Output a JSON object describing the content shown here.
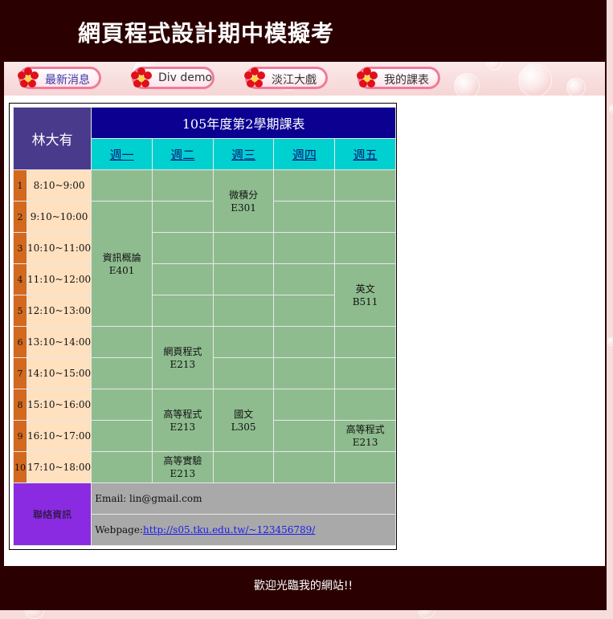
{
  "header": {
    "title": "網頁程式設計期中模擬考"
  },
  "nav": {
    "items": [
      {
        "label": "最新消息"
      },
      {
        "label": "Div demo"
      },
      {
        "label": "淡江大戲"
      },
      {
        "label": "我的課表"
      }
    ]
  },
  "schedule": {
    "owner": "林大有",
    "title": "105年度第2學期課表",
    "days": [
      "週一",
      "週二",
      "週三",
      "週四",
      "週五"
    ],
    "periods": [
      {
        "num": "1",
        "time": "8:10~9:00"
      },
      {
        "num": "2",
        "time": "9:10~10:00"
      },
      {
        "num": "3",
        "time": "10:10~11:00"
      },
      {
        "num": "4",
        "time": "11:10~12:00"
      },
      {
        "num": "5",
        "time": "12:10~13:00"
      },
      {
        "num": "6",
        "time": "13:10~14:00"
      },
      {
        "num": "7",
        "time": "14:10~15:00"
      },
      {
        "num": "8",
        "time": "15:10~16:00"
      },
      {
        "num": "9",
        "time": "16:10~17:00"
      },
      {
        "num": "10",
        "time": "17:10~18:00"
      }
    ],
    "courses": {
      "calculus": {
        "name": "微積分",
        "room": "E301"
      },
      "intro_cs": {
        "name": "資訊概論",
        "room": "E401"
      },
      "english": {
        "name": "英文",
        "room": "B511"
      },
      "web_prog": {
        "name": "網頁程式",
        "room": "E213"
      },
      "adv_prog_tue": {
        "name": "高等程式",
        "room": "E213"
      },
      "chinese": {
        "name": "國文",
        "room": "L305"
      },
      "adv_prog_fri": {
        "name": "高等程式",
        "room": "E213"
      },
      "adv_lab": {
        "name": "高等實驗",
        "room": "E213"
      }
    },
    "contact": {
      "label": "聯絡資訊",
      "email": "Email: lin@gmail.com",
      "webpage_prefix": "Webpage:",
      "webpage_link": "http://s05.tku.edu.tw/~123456789/"
    }
  },
  "footer": {
    "text": "歡迎光臨我的網站!!"
  },
  "colors": {
    "frame": "#2b0000",
    "owner_bg": "#493a8c",
    "title_bg": "#0b0090",
    "day_bg": "#00d0d0",
    "period_bg": "#d2691e",
    "time_bg": "#ffe0bf",
    "cell_bg": "#8fbc8f",
    "contact_label_bg": "#8a2be2",
    "contact_bg": "#a9a9a9"
  },
  "icons": {
    "nav_icon": "red-flower-icon"
  }
}
